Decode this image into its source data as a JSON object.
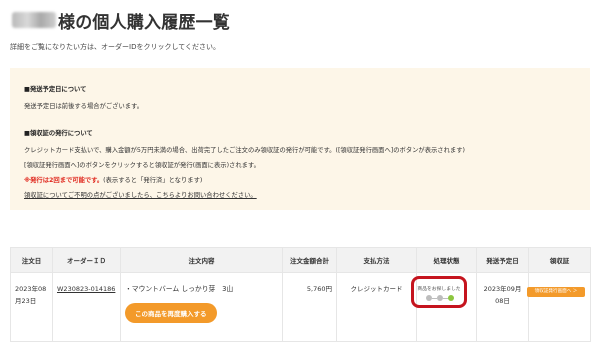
{
  "header": {
    "title": "様の個人購入履歴一覧"
  },
  "intro": "詳細をご覧になりたい方は、オーダーIDをクリックしてください。",
  "notice": {
    "ship_heading": "■発送予定日について",
    "ship_text": "発送予定日は前後する場合がございます。",
    "receipt_heading": "■領収証の発行について",
    "receipt_line1": "クレジットカード支払いで、購入金額が5万円未満の場合、出荷完了したご注文のみ領収証の発行が可能です。([領収証発行画面へ]のボタンが表示されます)",
    "receipt_line2": "[領収証発行画面へ]のボタンをクリックすると領収証が発行(画面に表示)されます。",
    "receipt_warning": "※発行は2回まで可能です。",
    "receipt_warning_rest": "(表示すると「発行済」となります)",
    "contact_link": "領収証についてご不明の点がございましたら、こちらよりお問い合わせください。"
  },
  "table": {
    "headers": [
      "注文日",
      "オーダーＩＤ",
      "注文内容",
      "注文金額合計",
      "支払方法",
      "処理状態",
      "発送予定日",
      "領収証"
    ],
    "row": {
      "order_date": "2023年08月23日",
      "order_id": "W230823-014186",
      "item": "・マウントバーム しっかり芽　3山",
      "reorder_label": "この商品を再度購入する",
      "amount": "5,760円",
      "payment": "クレジットカード",
      "status": "商品をお探しました",
      "ship_date": "2023年09月08日",
      "receipt_label": "領収証発行画面へ ＞"
    }
  },
  "colors": {
    "accent": "#f39a2a",
    "highlight": "#c5141e",
    "status_active": "#8cc63f",
    "notice_bg": "#fdf6e8"
  }
}
